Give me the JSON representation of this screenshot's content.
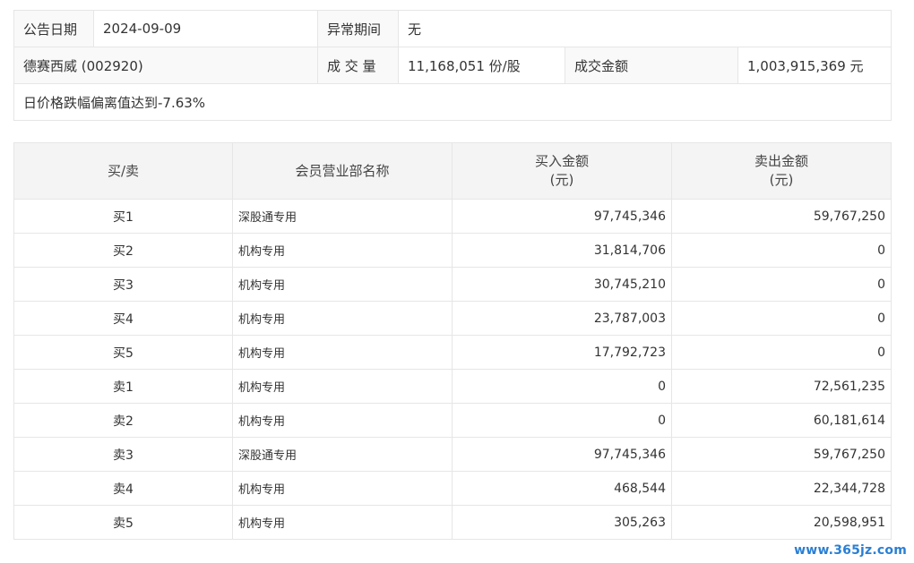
{
  "info": {
    "announce_label": "公告日期",
    "announce_date": "2024-09-09",
    "abnormal_label": "异常期间",
    "abnormal_value": "无",
    "stock": "德赛西威 (002920)",
    "volume_label": "成 交 量",
    "volume_value": "11,168,051 份/股",
    "turnover_label": "成交金额",
    "turnover_value": "1,003,915,369 元",
    "summary": "日价格跌幅偏离值达到-7.63%"
  },
  "table": {
    "headers": {
      "side": "买/卖",
      "dept": "会员营业部名称",
      "buy_line1": "买入金额",
      "buy_line2": "(元)",
      "sell_line1": "卖出金额",
      "sell_line2": "(元)"
    },
    "rows": [
      {
        "side": "买1",
        "dept": "深股通专用",
        "buy": "97,745,346",
        "sell": "59,767,250"
      },
      {
        "side": "买2",
        "dept": "机构专用",
        "buy": "31,814,706",
        "sell": "0"
      },
      {
        "side": "买3",
        "dept": "机构专用",
        "buy": "30,745,210",
        "sell": "0"
      },
      {
        "side": "买4",
        "dept": "机构专用",
        "buy": "23,787,003",
        "sell": "0"
      },
      {
        "side": "买5",
        "dept": "机构专用",
        "buy": "17,792,723",
        "sell": "0"
      },
      {
        "side": "卖1",
        "dept": "机构专用",
        "buy": "0",
        "sell": "72,561,235"
      },
      {
        "side": "卖2",
        "dept": "机构专用",
        "buy": "0",
        "sell": "60,181,614"
      },
      {
        "side": "卖3",
        "dept": "深股通专用",
        "buy": "97,745,346",
        "sell": "59,767,250"
      },
      {
        "side": "卖4",
        "dept": "机构专用",
        "buy": "468,544",
        "sell": "22,344,728"
      },
      {
        "side": "卖5",
        "dept": "机构专用",
        "buy": "305,263",
        "sell": "20,598,951"
      }
    ]
  },
  "watermark": "www.365jz.com"
}
